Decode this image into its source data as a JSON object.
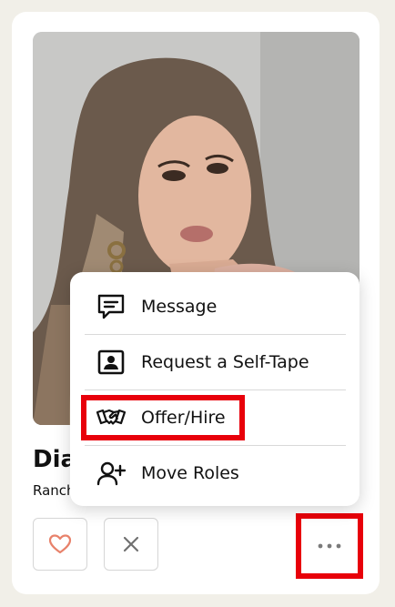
{
  "profile": {
    "name": "Diana",
    "location": "Rancho Cucamonga, CA"
  },
  "menu": {
    "items": [
      {
        "label": "Message",
        "icon": "message-icon"
      },
      {
        "label": "Request a Self-Tape",
        "icon": "self-tape-icon"
      },
      {
        "label": "Offer/Hire",
        "icon": "handshake-icon"
      },
      {
        "label": "Move Roles",
        "icon": "add-person-icon"
      }
    ]
  },
  "actions": {
    "like_icon": "heart-icon",
    "pass_icon": "close-icon",
    "more_icon": "more-dots-icon"
  },
  "colors": {
    "heart": "#e8826b",
    "highlight": "#e8000a",
    "background": "#f1efe8"
  }
}
